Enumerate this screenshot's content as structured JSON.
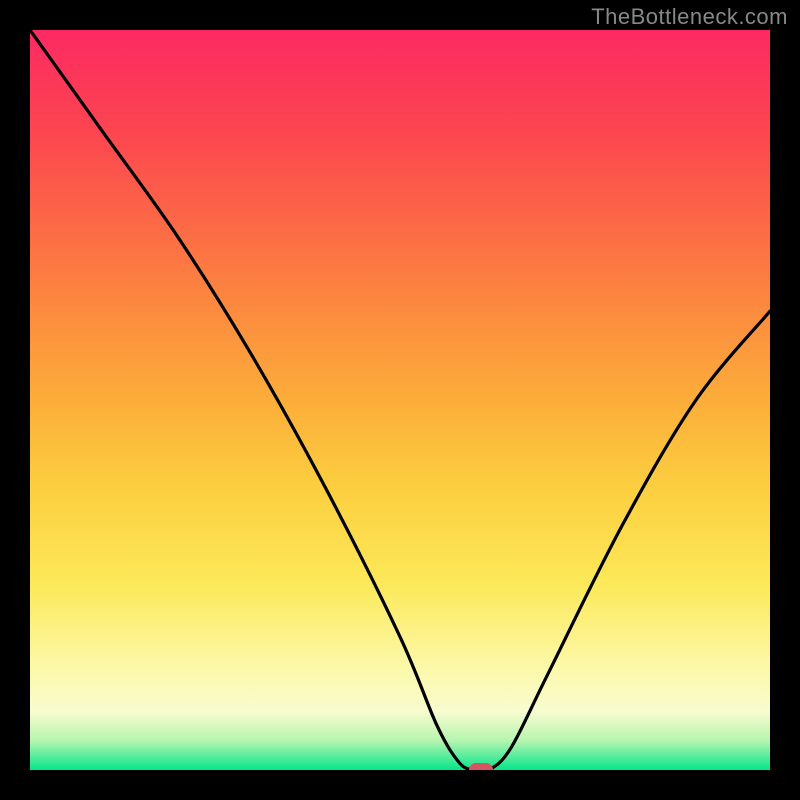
{
  "watermark": "TheBottleneck.com",
  "chart_data": {
    "type": "line",
    "title": "",
    "xlabel": "",
    "ylabel": "",
    "xlim": [
      0,
      100
    ],
    "ylim": [
      0,
      100
    ],
    "grid": false,
    "legend": false,
    "series": [
      {
        "name": "bottleneck-curve",
        "x": [
          0,
          10,
          20,
          30,
          40,
          50,
          55,
          58,
          60,
          62,
          65,
          70,
          80,
          90,
          100
        ],
        "values": [
          100,
          86,
          72,
          56,
          38,
          18,
          6,
          1,
          0,
          0,
          3,
          13,
          33,
          50,
          62
        ]
      }
    ],
    "annotations": [
      {
        "name": "min-marker",
        "x": 61,
        "y": 0,
        "shape": "pill",
        "color": "#d6565e"
      }
    ],
    "background": {
      "type": "vertical-gradient",
      "stops": [
        {
          "pos": 0.0,
          "color": "#05e58a"
        },
        {
          "pos": 0.06,
          "color": "#b7f5b0"
        },
        {
          "pos": 0.12,
          "color": "#fcf8a8"
        },
        {
          "pos": 0.3,
          "color": "#fce95a"
        },
        {
          "pos": 0.5,
          "color": "#fcad3a"
        },
        {
          "pos": 0.7,
          "color": "#fc6846"
        },
        {
          "pos": 1.0,
          "color": "#fc2a62"
        }
      ]
    }
  }
}
